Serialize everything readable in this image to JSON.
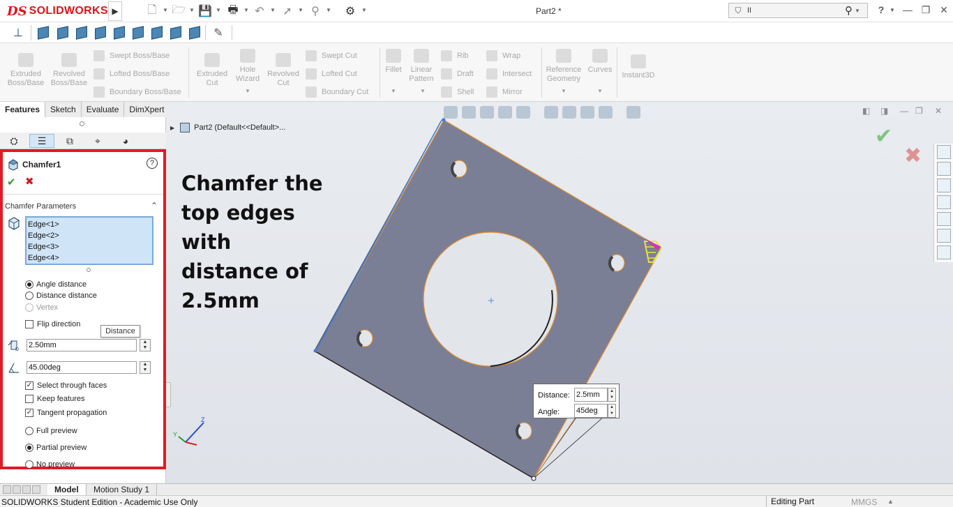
{
  "app": {
    "brand_mark": "DS",
    "brand_name": "SOLIDWORKS",
    "document_title": "Part2 *"
  },
  "search": {
    "value": "II",
    "placeholder": ""
  },
  "toolbar": {
    "help_label": "?"
  },
  "command_manager": {
    "features": [
      {
        "label": "Extruded Boss/Base"
      },
      {
        "label": "Revolved Boss/Base"
      },
      {
        "label": "Swept Boss/Base"
      },
      {
        "label": "Lofted Boss/Base"
      },
      {
        "label": "Boundary Boss/Base"
      },
      {
        "label": "Extruded Cut"
      },
      {
        "label": "Hole Wizard"
      },
      {
        "label": "Revolved Cut"
      },
      {
        "label": "Swept Cut"
      },
      {
        "label": "Lofted Cut"
      },
      {
        "label": "Boundary Cut"
      },
      {
        "label": "Fillet"
      },
      {
        "label": "Linear Pattern"
      },
      {
        "label": "Rib"
      },
      {
        "label": "Wrap"
      },
      {
        "label": "Draft"
      },
      {
        "label": "Intersect"
      },
      {
        "label": "Shell"
      },
      {
        "label": "Mirror"
      },
      {
        "label": "Reference Geometry"
      },
      {
        "label": "Curves"
      },
      {
        "label": "Instant3D"
      }
    ]
  },
  "tabs": [
    {
      "label": "Features"
    },
    {
      "label": "Sketch"
    },
    {
      "label": "Evaluate"
    },
    {
      "label": "DimXpert"
    }
  ],
  "property_manager": {
    "title": "Chamfer1",
    "help": "?",
    "ok": "✔",
    "cancel": "✖",
    "section_title": "Chamfer Parameters",
    "section_caret": "⌃",
    "edges": [
      "Edge<1>",
      "Edge<2>",
      "Edge<3>",
      "Edge<4>"
    ],
    "types": [
      {
        "label": "Angle distance"
      },
      {
        "label": "Distance distance"
      },
      {
        "label": "Vertex"
      }
    ],
    "flip_direction": "Flip direction",
    "distance_value": "2.50mm",
    "distance_tooltip": "Distance",
    "angle_value": "45.00deg",
    "options": [
      {
        "label": "Select through faces"
      },
      {
        "label": "Keep features"
      },
      {
        "label": "Tangent propagation"
      }
    ],
    "previews": [
      {
        "label": "Full preview"
      },
      {
        "label": "Partial preview"
      },
      {
        "label": "No preview"
      }
    ],
    "check_mark": "✓"
  },
  "tree": {
    "root_label": "Part2  (Default<<Default>..."
  },
  "annotation": {
    "text": "Chamfer the top edges with distance of 2.5mm"
  },
  "dimension_box": {
    "distance_label": "Distance:",
    "distance_value": "2.5mm",
    "angle_label": "Angle:",
    "angle_value": "45deg"
  },
  "triad": {
    "y": "Y",
    "z": "Z"
  },
  "bottom_tabs": [
    {
      "label": "Model"
    },
    {
      "label": "Motion Study 1"
    }
  ],
  "status": {
    "edition": "SOLIDWORKS Student Edition - Academic Use Only",
    "mode": "Editing Part",
    "units": "MMGS"
  },
  "colors": {
    "accent_red": "#e01b24",
    "brand_red": "#e1141a",
    "part_face": "#7a7f95",
    "edge_highlight": "#e8902a"
  }
}
